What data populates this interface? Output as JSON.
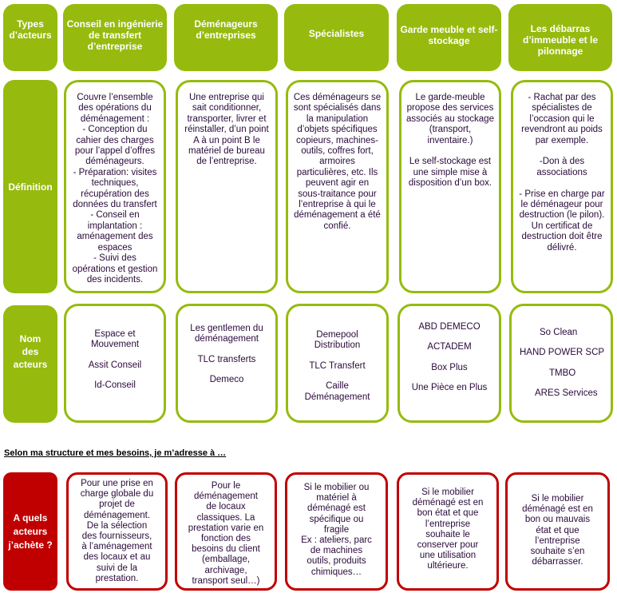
{
  "colors": {
    "green": "#96bb0e",
    "red": "#c00000",
    "text": "#2a0a3a"
  },
  "header": {
    "label": "Types\nd’acteurs",
    "columns": [
      "Conseil en ingénierie de transfert d’entreprise",
      "Déménageurs d’entreprises",
      "Spécialistes",
      "Garde meuble et self-stockage",
      "Les débarras d’immeuble et le pilonnage"
    ]
  },
  "definition": {
    "label": "Définition",
    "cells": [
      "Couvre l’ensemble\ndes opérations du\ndéménagement :\n- Conception du\ncahier des charges\npour l’appel d’offres\ndéménageurs.\n- Préparation: visites\ntechniques,\nrécupération des\ndonnées du transfert\n- Conseil en\nimplantation :\naménagement des\nespaces\n- Suivi des\nopérations et gestion\ndes incidents.",
      "Une entreprise qui\nsait conditionner,\ntransporter, livrer et\nréinstaller, d’un point\nA à un point B le\nmatériel de bureau\nde l’entreprise.",
      "Ces déménageurs se\nsont spécialisés dans\nla manipulation\nd’objets spécifiques\ncopieurs, machines-\noutils, coffres fort,\narmoires\nparticulières, etc. Ils\npeuvent agir en\nsous-traitance pour\nl’entreprise à qui le\ndéménagement a été\nconfié.",
      "Le garde-meuble\npropose des services\nassociés au stockage\n(transport,\ninventaire.)\n\nLe self-stockage est\nune simple mise à\ndisposition d’un box.",
      "- Rachat par des\nspécialistes de\nl’occasion qui le\nrevendront au poids\npar exemple.\n\n-Don à des\nassociations\n\n- Prise en charge par\nle déménageur pour\ndestruction (le pilon).\nUn certificat de\ndestruction doit être\ndélivré."
    ]
  },
  "actors": {
    "label": "Nom\ndes\nacteurs",
    "cells": [
      [
        "Espace et\nMouvement",
        "Assit Conseil",
        "Id-Conseil"
      ],
      [
        "Les gentlemen du\ndéménagement",
        "TLC transferts",
        "Demeco"
      ],
      [
        "Demepool\nDistribution",
        "TLC Transfert",
        "Caille\nDéménagement"
      ],
      [
        "ABD DEMECO",
        "ACTADEM",
        "Box Plus",
        "Une Pièce en Plus"
      ],
      [
        "So Clean",
        "HAND POWER SCP",
        "TMBO",
        "ARES Services"
      ]
    ]
  },
  "subtitle": "Selon ma structure et mes besoins, je m’adresse à …",
  "purchase": {
    "label": "A quels\nacteurs\nj’achète ?",
    "cells": [
      "Pour une prise en\ncharge globale du\nprojet de\ndéménagement.\nDe la sélection\ndes fournisseurs,\nà l’aménagement\ndes locaux et au\nsuivi de la\nprestation.",
      "Pour le\ndéménagement\nde locaux\nclassiques. La\nprestation varie en\nfonction des\nbesoins du client\n(emballage,\narchivage,\ntransport seul…)",
      "Si le mobilier ou\nmatériel à\ndéménagé est\nspécifique ou\nfragile\nEx : ateliers, parc\nde machines\noutils, produits\nchimiques…",
      "Si le mobilier\ndéménagé est en\nbon état et que\nl’entreprise\nsouhaite le\nconserver pour\nune utilisation\nultérieure.",
      "Si le mobilier\ndéménagé est en\nbon ou mauvais\nétat et que\nl’entreprise\nsouhaite s’en\ndébarrasser."
    ]
  }
}
